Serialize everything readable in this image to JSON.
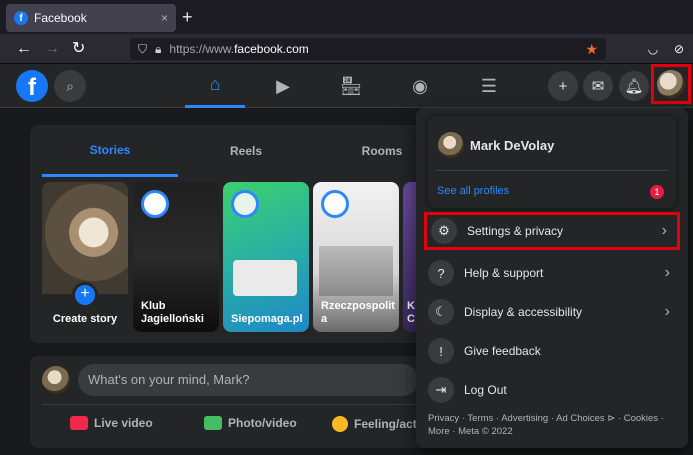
{
  "browser": {
    "tab_title": "Facebook",
    "tab_close": "×",
    "new_tab": "+",
    "url_prefix": "https://www.",
    "url_host": "facebook.com"
  },
  "header": {
    "logo": "f",
    "nav": [
      {
        "name": "home-icon",
        "active": true
      },
      {
        "name": "watch-icon",
        "active": false
      },
      {
        "name": "marketplace-icon",
        "active": false
      },
      {
        "name": "groups-icon",
        "active": false
      },
      {
        "name": "menu-icon",
        "active": false
      }
    ]
  },
  "stories": {
    "tabs": [
      "Stories",
      "Reels",
      "Rooms"
    ],
    "create_label": "Create story",
    "cards": [
      {
        "label": "Klub Jagielloński"
      },
      {
        "label": "Siepomaga.pl"
      },
      {
        "label": "Rzeczpospolit a"
      },
      {
        "label": "K C"
      }
    ]
  },
  "composer": {
    "placeholder": "What's on your mind, Mark?",
    "actions": [
      "Live video",
      "Photo/video",
      "Feeling/acti"
    ]
  },
  "account_menu": {
    "user_name": "Mark DeVolay",
    "see_all_profiles": "See all profiles",
    "badge_count": "1",
    "items": [
      {
        "label": "Settings & privacy",
        "icon": "gear-icon",
        "chevron": true
      },
      {
        "label": "Help & support",
        "icon": "question-icon",
        "chevron": true
      },
      {
        "label": "Display & accessibility",
        "icon": "moon-icon",
        "chevron": true
      },
      {
        "label": "Give feedback",
        "icon": "feedback-icon",
        "chevron": false
      },
      {
        "label": "Log Out",
        "icon": "logout-icon",
        "chevron": false
      }
    ],
    "footer": "Privacy · Terms · Advertising · Ad Choices ⊳ · Cookies · More · Meta © 2022"
  },
  "colors": {
    "accent": "#2d88ff",
    "highlight": "#e3000f",
    "badge": "#e41e3f",
    "bg": "#18191a",
    "surface": "#242526"
  }
}
